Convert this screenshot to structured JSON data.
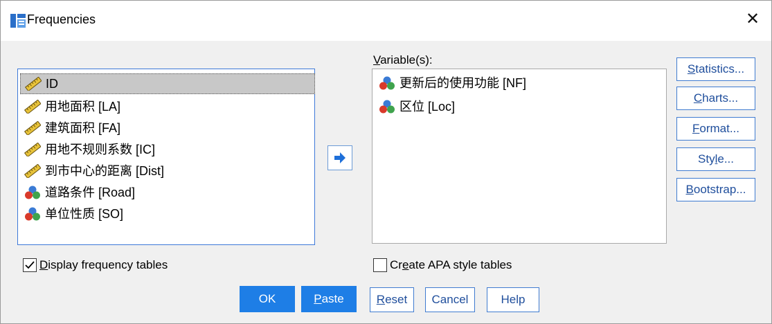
{
  "dialog": {
    "title": "Frequencies",
    "close_glyph": "✕"
  },
  "source_list": {
    "items": [
      {
        "label": "ID",
        "type": "scale",
        "selected": true
      },
      {
        "label": "用地面积 [LA]",
        "type": "scale"
      },
      {
        "label": "建筑面积 [FA]",
        "type": "scale"
      },
      {
        "label": "用地不规则系数 [IC]",
        "type": "scale"
      },
      {
        "label": "到市中心的距离 [Dist]",
        "type": "scale"
      },
      {
        "label": "道路条件 [Road]",
        "type": "nominal"
      },
      {
        "label": "单位性质 [SO]",
        "type": "nominal"
      }
    ]
  },
  "target_list": {
    "label_rest": "ariable(s):",
    "label_mnemonic": "V",
    "items": [
      {
        "label": "更新后的使用功能 [NF]",
        "type": "nominal"
      },
      {
        "label": "区位 [Loc]",
        "type": "nominal"
      }
    ]
  },
  "side_buttons": {
    "statistics": {
      "m": "S",
      "rest": "tatistics..."
    },
    "charts": {
      "m": "C",
      "rest": "harts..."
    },
    "format": {
      "m": "F",
      "rest": "ormat..."
    },
    "style": {
      "pre": "Sty",
      "m": "l",
      "rest": "e..."
    },
    "bootstrap": {
      "m": "B",
      "rest": "ootstrap..."
    }
  },
  "checkboxes": {
    "display_freq": {
      "m": "D",
      "rest": "isplay frequency tables",
      "checked": true
    },
    "apa": {
      "pre": "Cr",
      "m": "e",
      "rest": "ate APA style tables",
      "checked": false
    }
  },
  "bottom_buttons": {
    "ok": "OK",
    "paste": {
      "m": "P",
      "rest": "aste"
    },
    "reset": {
      "m": "R",
      "rest": "eset"
    },
    "cancel": "Cancel",
    "help": "Help"
  },
  "colors": {
    "accent": "#1e7ee6",
    "selection": "#c8c8c8",
    "link_text": "#1f4e9c"
  }
}
